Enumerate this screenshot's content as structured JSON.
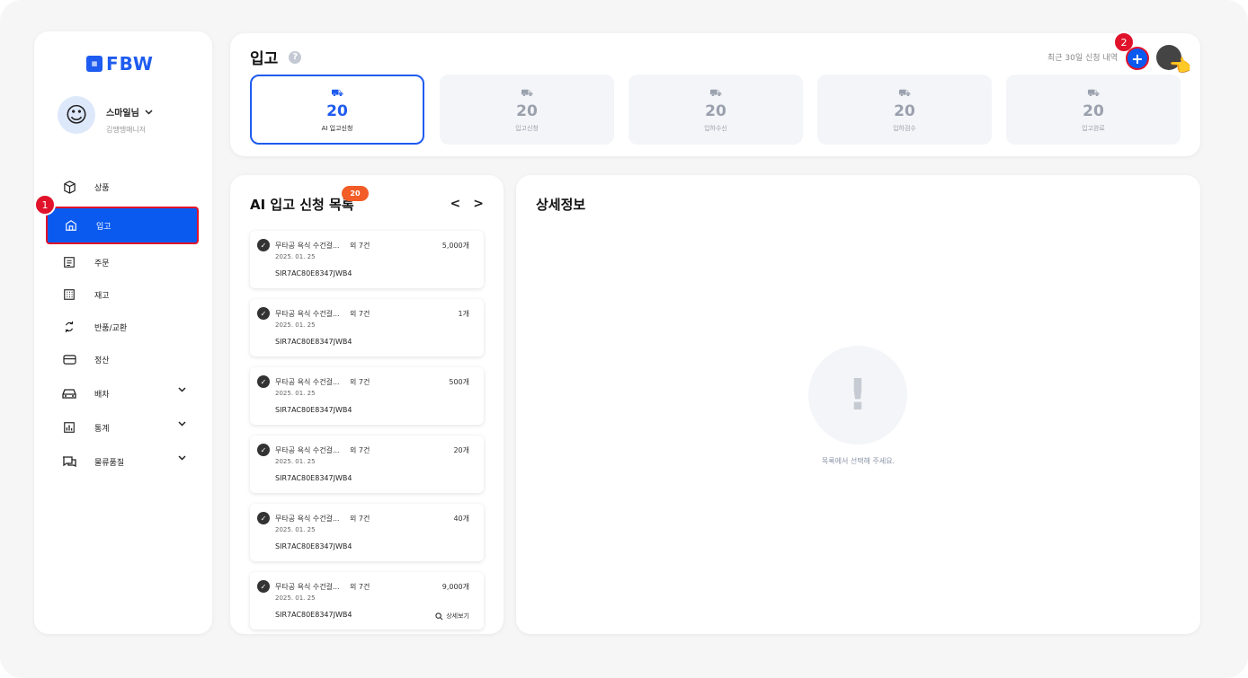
{
  "brand": {
    "logo_text": "FBW"
  },
  "user": {
    "name": "스마일님",
    "role": "김땡땡매니저"
  },
  "sidebar": {
    "items": [
      {
        "label": "상품",
        "icon": "box-icon"
      },
      {
        "label": "입고",
        "icon": "warehouse-icon",
        "active": true
      },
      {
        "label": "주문",
        "icon": "order-icon"
      },
      {
        "label": "재고",
        "icon": "grid-icon"
      },
      {
        "label": "반품/교환",
        "icon": "exchange-icon"
      },
      {
        "label": "정산",
        "icon": "card-icon"
      },
      {
        "label": "배차",
        "icon": "car-icon",
        "expandable": true
      },
      {
        "label": "통계",
        "icon": "chart-icon",
        "expandable": true
      },
      {
        "label": "물류품질",
        "icon": "chat-icon",
        "expandable": true
      }
    ],
    "marker": "1"
  },
  "header": {
    "title": "입고",
    "help": "?",
    "recent_label": "최근 30일 신청 내역",
    "plus": "+",
    "marker": "2"
  },
  "stats": [
    {
      "value": "20",
      "label": "AI 입고신청",
      "active": true
    },
    {
      "value": "20",
      "label": "입고신청"
    },
    {
      "value": "20",
      "label": "입하수신"
    },
    {
      "value": "20",
      "label": "입하검수"
    },
    {
      "value": "20",
      "label": "입고완료"
    }
  ],
  "list": {
    "title": "AI 입고 신청 목록",
    "count": "20",
    "prev": "<",
    "next": ">",
    "items": [
      {
        "name": "무타공 욕식 수건걸...",
        "count": "외 7건",
        "qty": "5,000개",
        "date": "2025. 01. 25",
        "code": "SIR7AC80E8347JWB4"
      },
      {
        "name": "무타공 욕식 수건걸...",
        "count": "외 7건",
        "qty": "1개",
        "date": "2025. 01. 25",
        "code": "SIR7AC80E8347JWB4"
      },
      {
        "name": "무타공 욕식 수건걸...",
        "count": "외 7건",
        "qty": "500개",
        "date": "2025. 01. 25",
        "code": "SIR7AC80E8347JWB4"
      },
      {
        "name": "무타공 욕식 수건걸...",
        "count": "외 7건",
        "qty": "20개",
        "date": "2025. 01. 25",
        "code": "SIR7AC80E8347JWB4"
      },
      {
        "name": "무타공 욕식 수건걸...",
        "count": "외 7건",
        "qty": "40개",
        "date": "2025. 01. 25",
        "code": "SIR7AC80E8347JWB4"
      },
      {
        "name": "무타공 욕식 수건걸...",
        "count": "외 7건",
        "qty": "9,000개",
        "date": "2025. 01. 25",
        "code": "SIR7AC80E8347JWB4",
        "detail": "상세보기"
      }
    ]
  },
  "detail": {
    "title": "상세정보",
    "empty_mark": "!",
    "empty_text": "목록에서 선택해 주세요."
  }
}
